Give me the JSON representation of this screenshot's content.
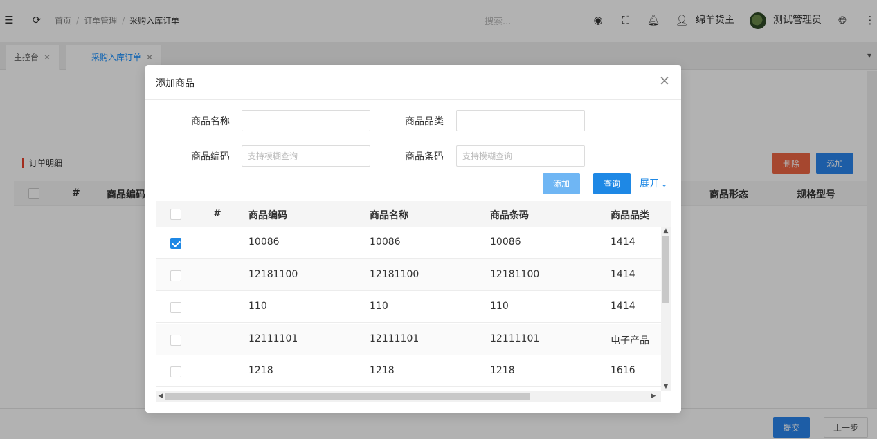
{
  "topbar": {
    "menu_icon": "menu-fold-icon",
    "refresh_icon": "refresh-icon",
    "breadcrumb": [
      "首页",
      "订单管理",
      "采购入库订单"
    ],
    "search_placeholder": "搜索...",
    "shipper": "绵羊货主",
    "admin": "测试管理员"
  },
  "tabs": [
    {
      "label": "主控台"
    },
    {
      "label": "采购入库订单"
    }
  ],
  "page": {
    "section_title": "订单明细",
    "delete_label": "删除",
    "add_label": "添加",
    "table_headers": [
      "#",
      "商品编码",
      "商品形态",
      "规格型号"
    ],
    "submit_label": "提交",
    "prev_label": "上一步"
  },
  "modal": {
    "title": "添加商品",
    "form": {
      "name_label": "商品名称",
      "name_value": "",
      "category_label": "商品品类",
      "category_value": "",
      "code_label": "商品编码",
      "code_placeholder": "支持模糊查询",
      "barcode_label": "商品条码",
      "barcode_placeholder": "支持模糊查询"
    },
    "add_label": "添加",
    "query_label": "查询",
    "expand_label": "展开",
    "table": {
      "headers": [
        "#",
        "商品编码",
        "商品名称",
        "商品条码",
        "商品品类"
      ],
      "rows": [
        {
          "checked": true,
          "code": "10086",
          "name": "10086",
          "barcode": "10086",
          "category": "1414"
        },
        {
          "checked": false,
          "code": "12181100",
          "name": "12181100",
          "barcode": "12181100",
          "category": "1414"
        },
        {
          "checked": false,
          "code": "110",
          "name": "110",
          "barcode": "110",
          "category": "1414"
        },
        {
          "checked": false,
          "code": "12111101",
          "name": "12111101",
          "barcode": "12111101",
          "category": "电子产品"
        },
        {
          "checked": false,
          "code": "1218",
          "name": "1218",
          "barcode": "1218",
          "category": "1616"
        }
      ]
    }
  }
}
